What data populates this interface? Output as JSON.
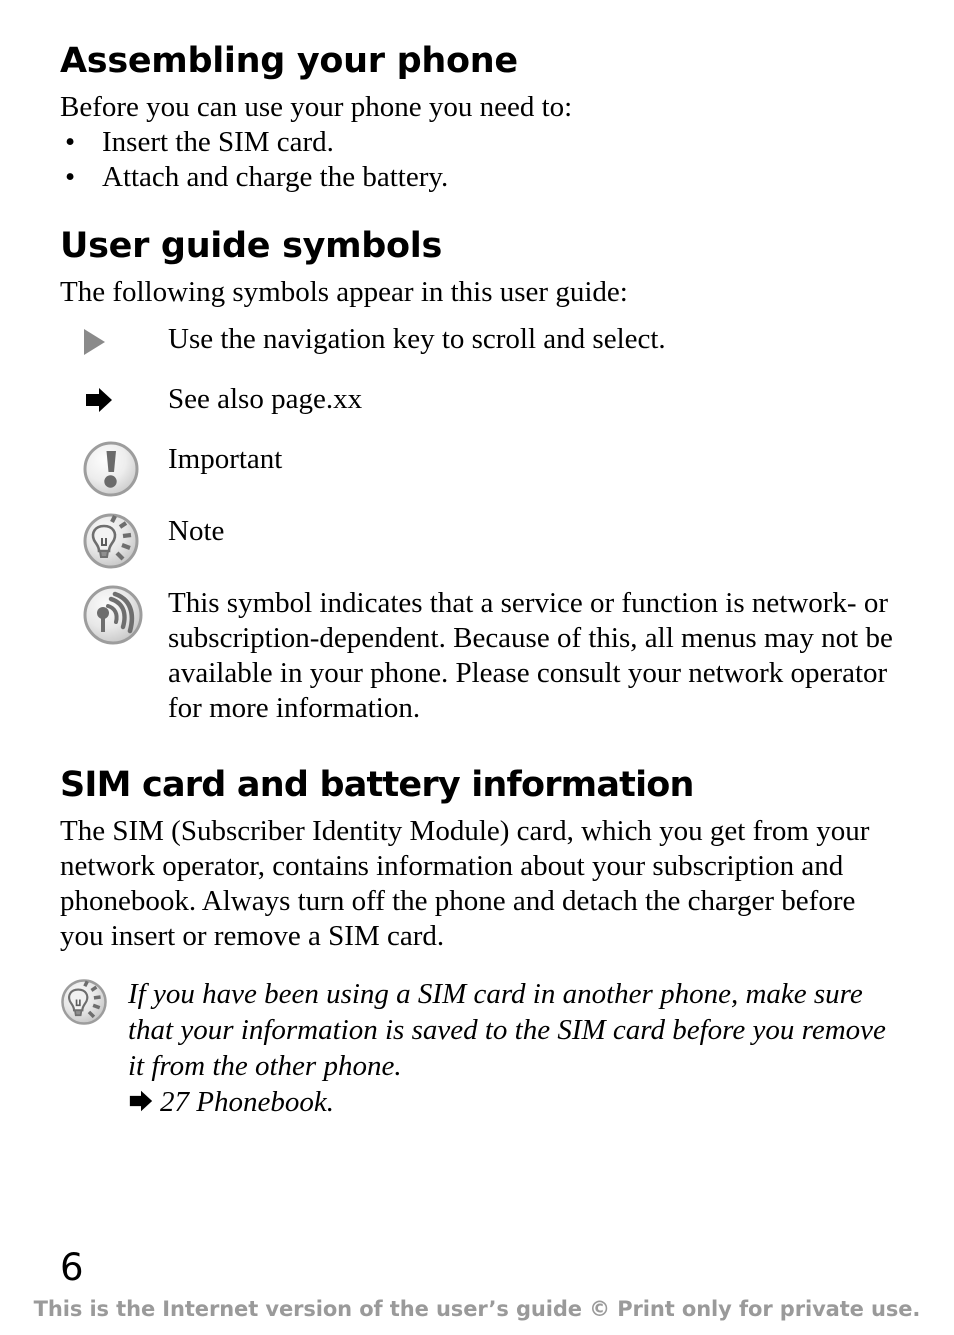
{
  "document": {
    "page_number": "6",
    "footer_text": "This is the Internet version of the user’s guide © Print only for private use."
  },
  "sections": [
    {
      "id": "assembling",
      "title": "Assembling your phone",
      "intro": "Before you can use your phone you need to:",
      "bullets": [
        "Insert the SIM card.",
        "Attach and charge the battery."
      ],
      "bullet_glyph": "•"
    },
    {
      "id": "user-guide-symbols",
      "title": "User guide symbols",
      "intro": "The following symbols appear in this user guide:",
      "symbol_rows": [
        {
          "icon": "triangle-right-icon",
          "text": "Use the navigation key to scroll and select."
        },
        {
          "icon": "block-arrow-right-icon",
          "text": "See also page.xx"
        },
        {
          "icon": "important-exclamation-icon",
          "text": "Important"
        },
        {
          "icon": "note-lightbulb-icon",
          "text": "Note"
        },
        {
          "icon": "network-signal-icon",
          "text": "This symbol indicates that a service or function is network- or subscription-dependent. Because of this, all menus may not be available in your phone. Please consult your network operator for more information."
        }
      ]
    },
    {
      "id": "sim-card-battery",
      "title": "SIM card and battery information",
      "body": "The SIM (Subscriber Identity Module) card, which you get from your network operator, contains information about your subscription and phonebook. Always turn off the phone and detach the charger before you insert or remove a SIM card.",
      "note": {
        "icon": "note-lightbulb-icon",
        "text": "If you have been using a SIM card in another phone, make sure that your information is saved to the SIM card before you remove it from the other phone.",
        "reference": "27 Phonebook.",
        "reference_icon": "block-arrow-right-icon"
      }
    }
  ],
  "colors": {
    "text": "#000000",
    "footer_gray": "#9a9a9a",
    "triangle_gray": "#8a8a8a",
    "icon_fill_light": "#e8e8e8",
    "icon_fill_dark": "#6e6e6e"
  }
}
